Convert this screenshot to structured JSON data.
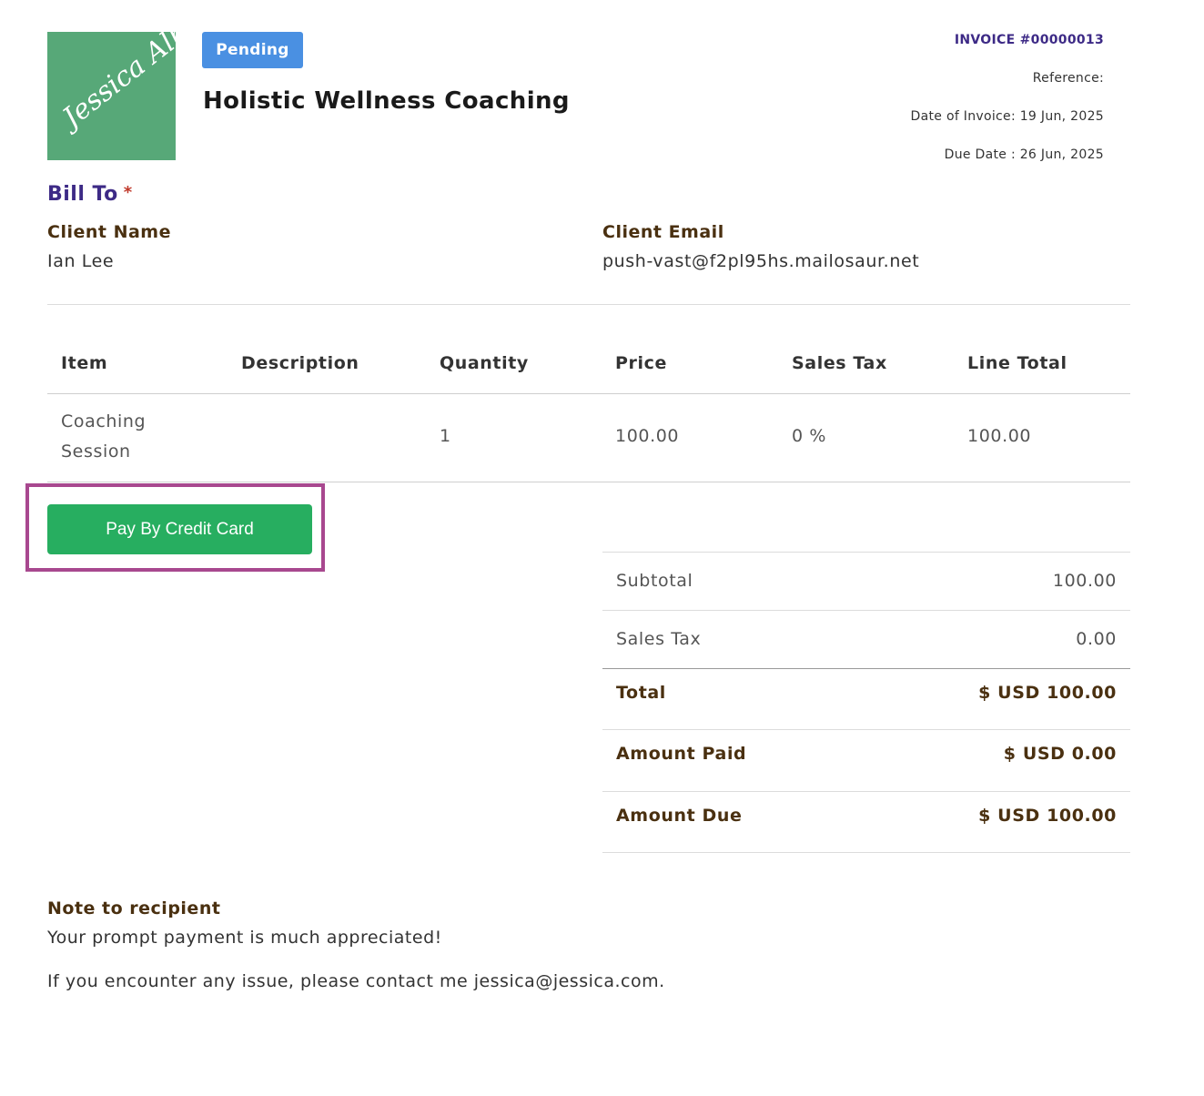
{
  "header": {
    "logo_text": "Jessica Albert",
    "status_badge": "Pending",
    "business_name": "Holistic Wellness Coaching",
    "invoice_number": "INVOICE #00000013",
    "reference": "Reference:",
    "date_of_invoice": "Date of Invoice: 19 Jun, 2025",
    "due_date": "Due Date : 26 Jun, 2025"
  },
  "bill_to": {
    "title": "Bill To",
    "required_marker": "*",
    "client_name_label": "Client Name",
    "client_name": "Ian Lee",
    "client_email_label": "Client Email",
    "client_email": "push-vast@f2pl95hs.mailosaur.net"
  },
  "table": {
    "headers": [
      "Item",
      "Description",
      "Quantity",
      "Price",
      "Sales Tax",
      "Line Total"
    ],
    "rows": [
      {
        "item_line1": "Coaching",
        "item_line2": "Session",
        "description": "",
        "quantity": "1",
        "price": "100.00",
        "sales_tax": "0 %",
        "line_total": "100.00"
      }
    ]
  },
  "pay_button": "Pay By Credit Card",
  "totals": {
    "subtotal_label": "Subtotal",
    "subtotal": "100.00",
    "sales_tax_label": "Sales Tax",
    "sales_tax": "0.00",
    "total_label": "Total",
    "total": "$ USD 100.00",
    "amount_paid_label": "Amount Paid",
    "amount_paid": "$ USD 0.00",
    "amount_due_label": "Amount Due",
    "amount_due": "$ USD 100.00"
  },
  "note": {
    "label": "Note to recipient",
    "line1": "Your prompt payment is much appreciated!",
    "line2": "If you encounter any issue, please contact me jessica@jessica.com."
  },
  "colors": {
    "logo_bg": "#57a878",
    "badge_bg": "#4a90e2",
    "pay_button_bg": "#27ae60",
    "highlight_border": "#a8488f",
    "heading_purple": "#3d2a86",
    "label_brown": "#4a3010"
  }
}
